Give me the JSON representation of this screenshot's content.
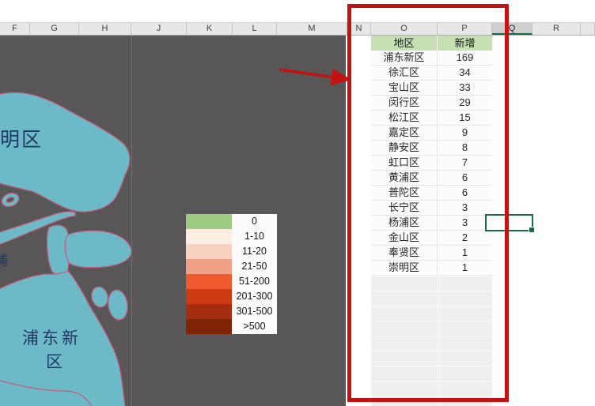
{
  "sheet": {
    "columns": [
      "F",
      "G",
      "H",
      "J",
      "K",
      "L",
      "M",
      "N",
      "O",
      "P",
      "Q",
      "R",
      ""
    ],
    "selected_column": "Q"
  },
  "table": {
    "headers": [
      "地区",
      "新增"
    ],
    "rows": [
      [
        "浦东新区",
        "169"
      ],
      [
        "徐汇区",
        "34"
      ],
      [
        "宝山区",
        "33"
      ],
      [
        "闵行区",
        "29"
      ],
      [
        "松江区",
        "15"
      ],
      [
        "嘉定区",
        "9"
      ],
      [
        "静安区",
        "8"
      ],
      [
        "虹口区",
        "7"
      ],
      [
        "黄浦区",
        "6"
      ],
      [
        "普陀区",
        "6"
      ],
      [
        "长宁区",
        "3"
      ],
      [
        "杨浦区",
        "3"
      ],
      [
        "金山区",
        "2"
      ],
      [
        "奉贤区",
        "1"
      ],
      [
        "崇明区",
        "1"
      ]
    ]
  },
  "legend": {
    "items": [
      {
        "label": "0",
        "color": "#9CCB81"
      },
      {
        "label": "1-10",
        "color": "#FBEDE3"
      },
      {
        "label": "11-20",
        "color": "#F8D2BE"
      },
      {
        "label": "21-50",
        "color": "#F2A189"
      },
      {
        "label": "51-200",
        "color": "#EF5A2F"
      },
      {
        "label": "201-300",
        "color": "#CC3B13"
      },
      {
        "label": "301-500",
        "color": "#A62D10"
      },
      {
        "label": ">500",
        "color": "#7F2407"
      }
    ]
  },
  "map": {
    "labels": {
      "chongming_partial": "明区",
      "pu_partial": "浦",
      "pudong_line1": "浦东新",
      "pudong_line2": "区"
    },
    "colors": {
      "background": "#595657",
      "region_fill": "#6CB9C8",
      "region_outline": "#C06080",
      "label_text": "#1F3864"
    }
  },
  "annotations": {
    "highlight_color": "#C31212"
  },
  "active_cell": {
    "border_color": "#1B6B45"
  }
}
